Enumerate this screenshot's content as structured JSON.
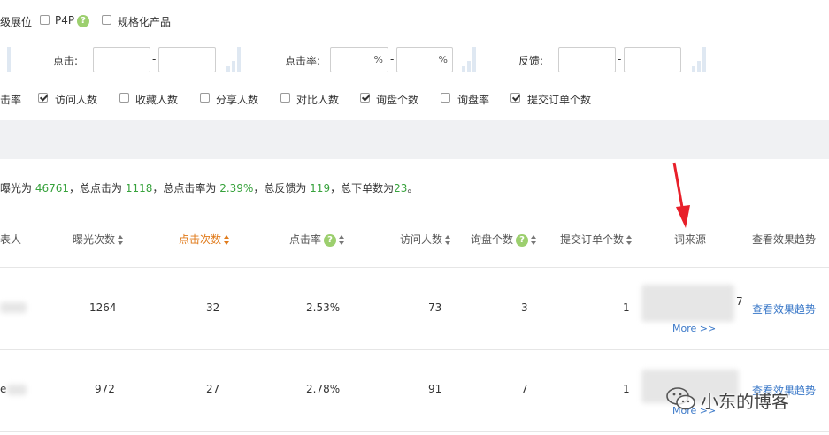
{
  "filters": {
    "row1": [
      {
        "label": "级展位",
        "has_checkbox": false
      },
      {
        "label": "P4P",
        "checked": false,
        "help": "?"
      },
      {
        "label": "规格化产品",
        "checked": false
      }
    ],
    "click_label": "点击:",
    "click_sep": "-",
    "ctr_label": "点击率:",
    "ctr_unit": "%",
    "ctr_sep": "-",
    "feedback_label": "反馈:",
    "feedback_sep": "-",
    "columns": [
      {
        "label": "击率",
        "has_checkbox": false
      },
      {
        "label": "访问人数",
        "checked": true
      },
      {
        "label": "收藏人数",
        "checked": false
      },
      {
        "label": "分享人数",
        "checked": false
      },
      {
        "label": "对比人数",
        "checked": false
      },
      {
        "label": "询盘个数",
        "checked": true
      },
      {
        "label": "询盘率",
        "checked": false
      },
      {
        "label": "提交订单个数",
        "checked": true
      }
    ]
  },
  "summary": {
    "p1": "曝光为 ",
    "v1": "46761",
    "p2": "，总点击为 ",
    "v2": "1118",
    "p3": "，总点击率为 ",
    "v3": "2.39%",
    "p4": "，总反馈为 ",
    "v4": "119",
    "p5": "，总下单数为",
    "v5": "23",
    "p6": "。"
  },
  "table": {
    "headers": {
      "col0": "表人",
      "impressions": "曝光次数",
      "clicks": "点击次数",
      "ctr": "点击率",
      "visitors": "访问人数",
      "inquiries": "询盘个数",
      "orders": "提交订单个数",
      "source": "词来源",
      "trend": "查看效果趋势"
    },
    "rows": [
      {
        "prefix": "",
        "impressions": "1264",
        "clicks": "32",
        "ctr": "2.53%",
        "visitors": "73",
        "inquiries": "3",
        "orders": "1",
        "source_tail": "7",
        "more": "More >>",
        "trend": "查看效果趋势"
      },
      {
        "prefix": "e",
        "impressions": "972",
        "clicks": "27",
        "ctr": "2.78%",
        "visitors": "91",
        "inquiries": "7",
        "orders": "1",
        "source_tail": "",
        "more": "More >>",
        "trend": "查看效果趋势"
      }
    ]
  },
  "watermark": "小东的博客",
  "colors": {
    "accent_green": "#37a23c",
    "link_blue": "#3a78c8",
    "sorted_orange": "#e07a1a",
    "arrow_red": "#e8202a",
    "band_gray": "#f0f1f3"
  }
}
